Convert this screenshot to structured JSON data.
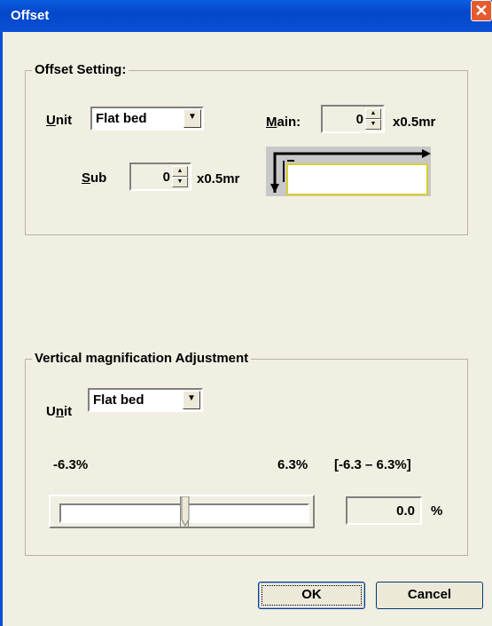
{
  "window": {
    "title": "Offset"
  },
  "offset": {
    "legend": "Offset Setting:",
    "unit_label_pre": "",
    "unit_label_u": "U",
    "unit_label_post": "nit",
    "unit_value": "Flat bed",
    "main_label_u": "M",
    "main_label_post": "ain:",
    "main_value": "0",
    "main_unit": "x0.5mr",
    "sub_label_u": "S",
    "sub_label_post": "ub",
    "sub_value": "0",
    "sub_unit": "x0.5mr"
  },
  "vertical": {
    "legend": "Vertical magnification Adjustment",
    "unit_label_pre": "U",
    "unit_label_u": "n",
    "unit_label_post": "it",
    "unit_value": "Flat bed",
    "min_label": "-6.3%",
    "max_label": "6.3%",
    "range_label": "[-6.3 – 6.3%]",
    "value": "0.0",
    "percent": "%",
    "slider_fraction": 0.5
  },
  "buttons": {
    "ok": "OK",
    "cancel": "Cancel"
  },
  "icons": {
    "close": "close-icon",
    "combo_arrow": "chevron-down-icon",
    "spin": "spin-arrows-icon"
  }
}
